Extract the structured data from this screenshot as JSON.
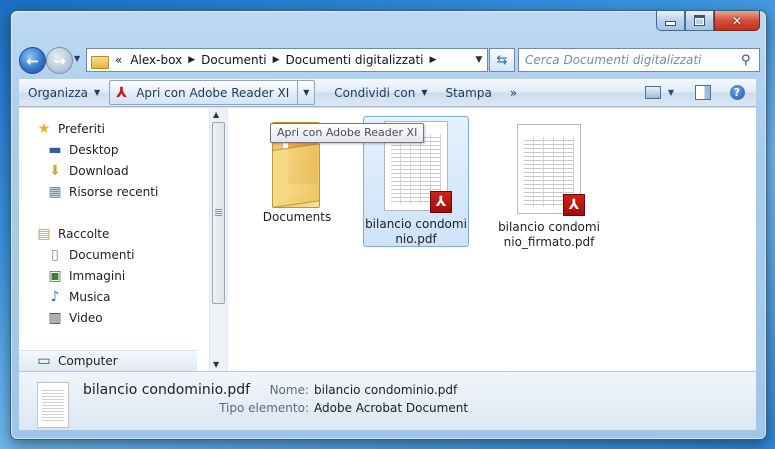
{
  "window": {
    "title": "Documenti digitalizzati"
  },
  "nav": {
    "back_icon": "back-arrow-icon",
    "forward_icon": "forward-arrow-icon",
    "breadcrumb": [
      "Alex-box",
      "Documenti",
      "Documenti digitalizzati"
    ],
    "overflow": "«",
    "search_placeholder": "Cerca Documenti digitalizzati"
  },
  "toolbar": {
    "organize": "Organizza",
    "open_with": "Apri con Adobe Reader XI",
    "share": "Condividi con",
    "print": "Stampa",
    "more": "»"
  },
  "sidebar": {
    "favorites_label": "Preferiti",
    "favorites": [
      "Desktop",
      "Download",
      "Risorse recenti"
    ],
    "libraries_label": "Raccolte",
    "libraries": [
      "Documenti",
      "Immagini",
      "Musica",
      "Video"
    ],
    "computer_label": "Computer"
  },
  "files": [
    {
      "name": "Documents",
      "type": "folder",
      "selected": false
    },
    {
      "name": "bilancio condominio.pdf",
      "type": "pdf",
      "selected": true
    },
    {
      "name": "bilancio condominio_firmato.pdf",
      "type": "pdf",
      "selected": false
    }
  ],
  "tooltip": "Apri con Adobe Reader XI",
  "details": {
    "file_name": "bilancio condominio.pdf",
    "name_label": "Nome:",
    "name_value": "bilancio condominio.pdf",
    "type_label": "Tipo elemento:",
    "type_value": "Adobe Acrobat Document"
  },
  "colors": {
    "accent": "#3b95e0",
    "pdf_red": "#c51a14",
    "selection": "#cde3fa"
  }
}
